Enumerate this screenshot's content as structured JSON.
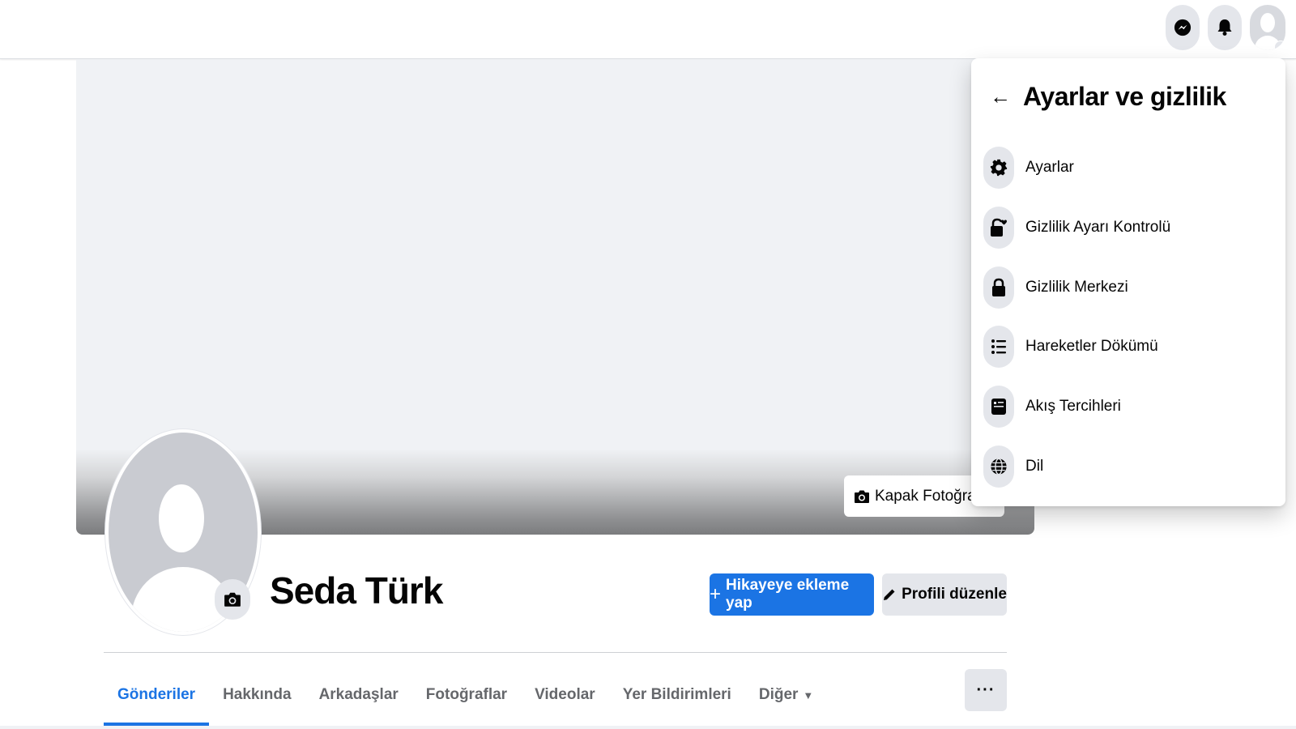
{
  "topbar": {
    "icons": [
      "messenger-icon",
      "bell-icon",
      "account-avatar-icon"
    ]
  },
  "cover": {
    "edit_cover_label": "Kapak Fotoğrafı"
  },
  "profile": {
    "name": "Seda Türk",
    "add_story_label": "Hikayeye ekleme yap",
    "edit_profile_label": "Profili düzenle"
  },
  "tabs": [
    {
      "label": "Gönderiler",
      "active": true
    },
    {
      "label": "Hakkında"
    },
    {
      "label": "Arkadaşlar"
    },
    {
      "label": "Fotoğraflar"
    },
    {
      "label": "Videolar"
    },
    {
      "label": "Yer Bildirimleri"
    },
    {
      "label": "Diğer"
    }
  ],
  "more_button": "···",
  "menu": {
    "title": "Ayarlar ve gizlilik",
    "items": [
      {
        "label": "Ayarlar",
        "icon": "gear-icon"
      },
      {
        "label": "Gizlilik Ayarı Kontrolü",
        "icon": "lock-heart-icon"
      },
      {
        "label": "Gizlilik Merkezi",
        "icon": "lock-icon"
      },
      {
        "label": "Hareketler Dökümü",
        "icon": "list-icon"
      },
      {
        "label": "Akış Tercihleri",
        "icon": "feed-icon"
      },
      {
        "label": "Dil",
        "icon": "globe-icon"
      }
    ]
  },
  "colors": {
    "accent": "#1b74e4",
    "button_gray": "#e4e6eb",
    "text": "#050505",
    "secondary_text": "#65676b"
  }
}
